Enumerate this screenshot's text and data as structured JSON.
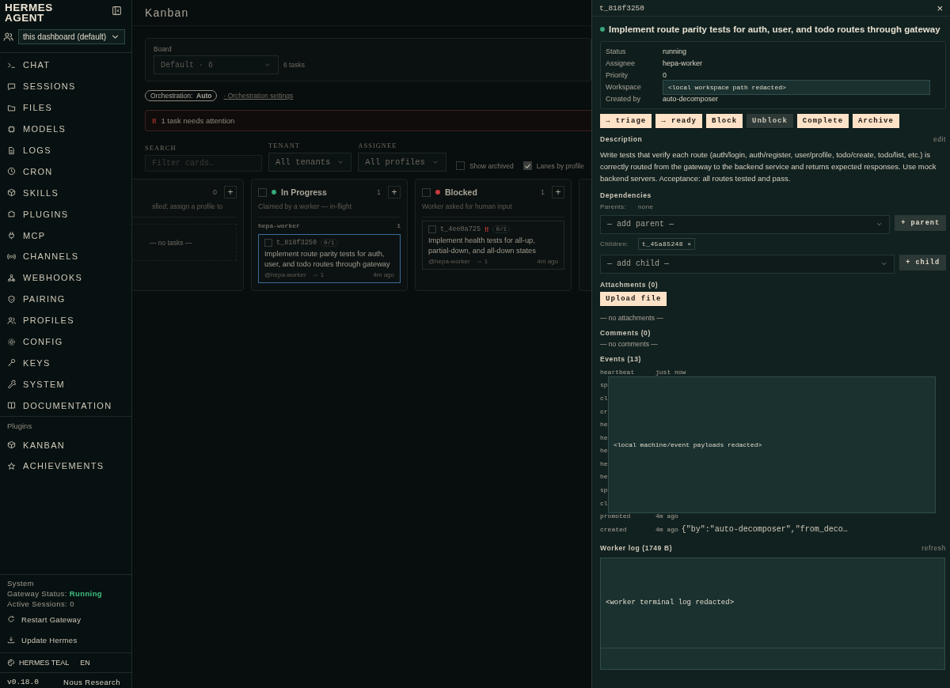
{
  "sidebar": {
    "brand": "HERMES AGENT",
    "profile_select": "this dashboard (default)",
    "nav": [
      {
        "label": "CHAT"
      },
      {
        "label": "SESSIONS"
      },
      {
        "label": "FILES"
      },
      {
        "label": "MODELS"
      },
      {
        "label": "LOGS"
      },
      {
        "label": "CRON"
      },
      {
        "label": "SKILLS"
      },
      {
        "label": "PLUGINS"
      },
      {
        "label": "MCP"
      },
      {
        "label": "CHANNELS"
      },
      {
        "label": "WEBHOOKS"
      },
      {
        "label": "PAIRING"
      },
      {
        "label": "PROFILES"
      },
      {
        "label": "CONFIG"
      },
      {
        "label": "KEYS"
      },
      {
        "label": "SYSTEM"
      },
      {
        "label": "DOCUMENTATION"
      }
    ],
    "plugins_heading": "Plugins",
    "plugins": [
      {
        "label": "KANBAN"
      },
      {
        "label": "ACHIEVEMENTS"
      }
    ],
    "system": {
      "heading": "System",
      "gateway_label": "Gateway Status:",
      "gateway_status": "Running",
      "sessions": "Active Sessions: 0"
    },
    "actions": [
      "Restart Gateway",
      "Update Hermes"
    ],
    "theme": "HERMES TEAL",
    "language": "EN",
    "version": "v0.18.0",
    "vendor": "Nous Research"
  },
  "main": {
    "title": "Kanban",
    "board": {
      "label": "Board",
      "select": "Default · 6",
      "count": "6 tasks"
    },
    "orchestration": {
      "pill": "Orchestration:  **Auto**",
      "link": "· Orchestration settings"
    },
    "attention": {
      "icon": "‼",
      "text": "1 task needs attention"
    },
    "filters": {
      "search_label": "SEARCH",
      "search_placeholder": "Filter cards…",
      "tenant_label": "TENANT",
      "tenant": "All tenants",
      "assignee_label": "ASSIGNEE",
      "assignee": "All profiles",
      "checks": [
        {
          "label": "Show archived",
          "checked": false
        },
        {
          "label": "Lanes by profile",
          "checked": true
        }
      ]
    },
    "lanes": [
      {
        "kind": "cut",
        "count": "0",
        "add": "+",
        "description": "sfied; assign a profile to",
        "empty": "— no tasks —"
      },
      {
        "kind": "full",
        "title": "In Progress",
        "color": "#3aa57a",
        "count": "1",
        "add": "+",
        "checked": false,
        "description": "Claimed by a worker — in-flight",
        "group": {
          "name": "hepa-worker",
          "count": "1"
        },
        "cards": [
          {
            "id": "t_818f3250",
            "checked": false,
            "progress": "0/1",
            "title": "Implement route parity tests for auth, user, and todo routes through gateway",
            "assignee": "@hepa-worker",
            "links": "⇔ 1",
            "time": "4m ago",
            "selected": true
          }
        ]
      },
      {
        "kind": "full",
        "title": "Blocked",
        "color": "#c83a3a",
        "count": "1",
        "add": "+",
        "checked": false,
        "description": "Worker asked for human input",
        "cards": [
          {
            "id": "t_4ee0a725",
            "checked": false,
            "flag": "‼",
            "progress": "0/1",
            "title": "Implement health tests for all-up, partial-down, and all-down states",
            "assignee": "@hepa-worker",
            "links": "⇔ 1",
            "time": "4m ago",
            "selected": false
          }
        ]
      }
    ]
  },
  "drawer": {
    "id": "t_818f3250",
    "close": "×",
    "title": "Implement route parity tests for auth, user, and todo routes through gateway",
    "meta": [
      {
        "label": "Status",
        "value": "running"
      },
      {
        "label": "Assignee",
        "value": "hepa-worker"
      },
      {
        "label": "Priority",
        "value": "0"
      },
      {
        "label": "Workspace",
        "value": "<local workspace path redacted>",
        "kind": "redacted"
      },
      {
        "label": "Created by",
        "value": "auto-decomposer"
      }
    ],
    "buttons": [
      {
        "label": "→ triage",
        "disabled": false
      },
      {
        "label": "→ ready",
        "disabled": false
      },
      {
        "label": "Block",
        "disabled": false
      },
      {
        "label": "Unblock",
        "disabled": true
      },
      {
        "label": "Complete",
        "disabled": false
      },
      {
        "label": "Archive",
        "disabled": false
      }
    ],
    "description_heading": "Description",
    "edit": "edit",
    "description": "Write tests that verify each route (auth/login, auth/register, user/profile, todo/create, todo/list, etc.) is correctly routed from the gateway to the backend service and returns expected responses. Use mock backend servers. Acceptance: all routes tested and pass.",
    "dependencies_heading": "Dependencies",
    "parents_label": "Parents:",
    "parents": "none",
    "parent_select": "— add parent —",
    "parent_button": "+ parent",
    "children_label": "Children:",
    "children": [
      {
        "id": "t_45a85248",
        "remove": "×"
      }
    ],
    "child_select": "— add child —",
    "child_button": "+ child",
    "attachments_heading": "Attachments (0)",
    "upload": "Upload file",
    "no_attachments": "— no attachments —",
    "comments_heading": "Comments (0)",
    "no_comments": "— no comments —",
    "events_heading": "Events (13)",
    "events": [
      {
        "name": "heartbeat",
        "time": "just now"
      },
      {
        "name": "sp"
      },
      {
        "name": "cl"
      },
      {
        "name": "cr"
      },
      {
        "name": "he"
      },
      {
        "name": "he"
      },
      {
        "name": "he"
      },
      {
        "name": "he"
      },
      {
        "name": "he"
      },
      {
        "name": "sp"
      },
      {
        "name": "cl"
      },
      {
        "name": "promoted",
        "time": "4m ago"
      },
      {
        "name": "created",
        "time": "4m ago",
        "payload": "{\"by\":\"auto-decomposer\",\"from_deco…"
      }
    ],
    "events_redacted": "<local machine/event payloads redacted>",
    "log_heading": "Worker log (1749 B)",
    "refresh": "refresh",
    "log": "<worker terminal log redacted>"
  }
}
